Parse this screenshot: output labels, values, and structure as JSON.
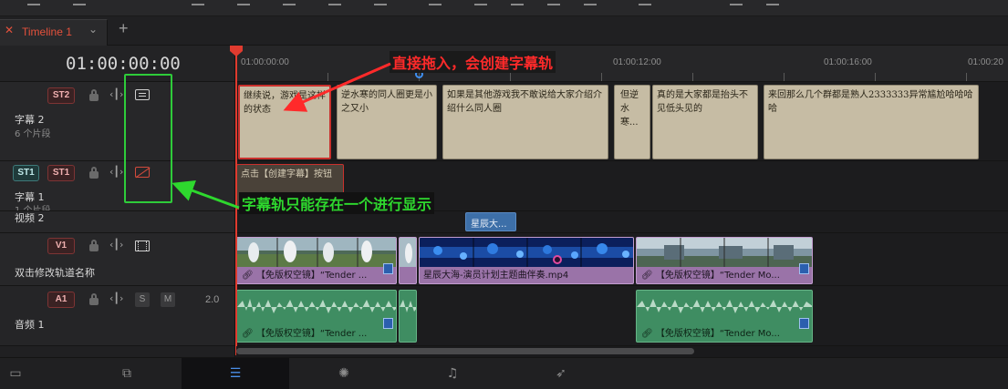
{
  "tab": {
    "label": "Timeline 1"
  },
  "timecode": "01:00:00:00",
  "ruler": {
    "labels": [
      "01:00:00:00",
      "01:00:04:00",
      "01:00:08:00",
      "01:00:12:00",
      "01:00:16:00",
      "01:00:20"
    ]
  },
  "tracks": {
    "st2": {
      "chip": "ST2",
      "name": "字幕 2",
      "sub": "6 个片段"
    },
    "st1": {
      "chip_dest": "ST1",
      "chip": "ST1",
      "name": "字幕 1",
      "sub": "1 个片段"
    },
    "v2": {
      "name": "视频 2"
    },
    "v1": {
      "chip": "V1",
      "name": "双击修改轨道名称"
    },
    "a1": {
      "chip": "A1",
      "name": "音频 1",
      "s": "S",
      "m": "M",
      "level": "2.0"
    }
  },
  "st2_clips": [
    "继续说，游戏是这样的状态",
    "逆水寒的同人圈更是小之又小",
    "如果是其他游戏我不敢说给大家介绍介绍什么同人圈",
    "但逆水寒...",
    "真的是大家都是抬头不见低头见的",
    "来回那么几个群都是熟人2333333异常尴尬哈哈哈哈"
  ],
  "st1_clip": "点击【创建字幕】按钮",
  "v2_clip": "星辰大...",
  "v1_clips": [
    "【免版权空镜】“Tender ...",
    "星辰大海-演员计划主题曲伴奏.mp4",
    "【免版权空镜】“Tender Mo..."
  ],
  "a1_clips": [
    "【免版权空镜】“Tender ...",
    "【免版权空镜】“Tender Mo..."
  ],
  "annotations": {
    "top": "直接拖入，会创建字幕轨",
    "mid": "字幕轨只能存在一个进行显示"
  },
  "colors": {
    "accent_red": "#e4513c",
    "subtitle_clip": "#c6bca4",
    "video_clip": "#9a73a8",
    "audio_clip": "#3f8d62",
    "annotation_red": "#ff2a2a",
    "annotation_green": "#2ed82e"
  },
  "pages": [
    "media-icon",
    "cut-icon",
    "edit-icon",
    "fusion-icon",
    "fairlight-icon",
    "deliver-icon"
  ]
}
